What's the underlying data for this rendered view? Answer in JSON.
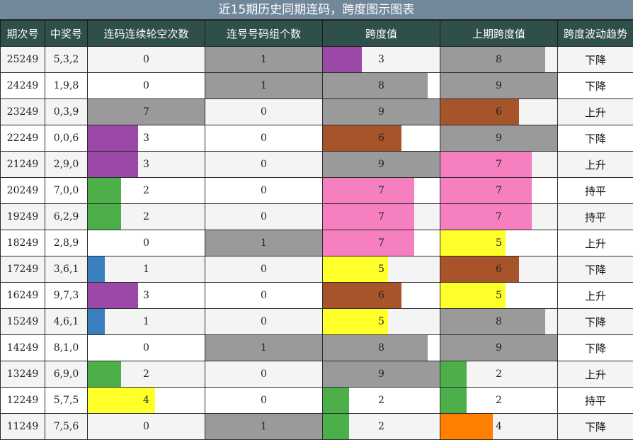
{
  "title": "近15期历史同期连码，跨度图示图表",
  "headers": [
    "期次号",
    "中奖号",
    "连码连续轮空次数",
    "连号号码组个数",
    "跨度值",
    "上期跨度值",
    "跨度波动趋势"
  ],
  "scale": {
    "miss_max": 7,
    "group_max": 1,
    "span_max": 9
  },
  "colors": {
    "1": "#3a7fc0",
    "2": "#4caf4a",
    "3": "#9a4aa6",
    "4": "#ffff2a",
    "5": "#ffff2a",
    "6": "#a8542a",
    "7": "#f57fbf",
    "8": "#9a9a9a",
    "9": "#9a9a9a",
    "4_prev": "#ff7f00"
  },
  "rows": [
    {
      "issue": "25249",
      "number": "5,3,2",
      "miss": 0,
      "groups": 1,
      "span": 3,
      "prev_span": 8,
      "trend": "下降"
    },
    {
      "issue": "24249",
      "number": "1,9,8",
      "miss": 0,
      "groups": 1,
      "span": 8,
      "prev_span": 9,
      "trend": "下降"
    },
    {
      "issue": "23249",
      "number": "0,3,9",
      "miss": 7,
      "groups": 0,
      "span": 9,
      "prev_span": 6,
      "trend": "上升"
    },
    {
      "issue": "22249",
      "number": "0,0,6",
      "miss": 3,
      "groups": 0,
      "span": 6,
      "prev_span": 9,
      "trend": "下降"
    },
    {
      "issue": "21249",
      "number": "2,9,0",
      "miss": 3,
      "groups": 0,
      "span": 9,
      "prev_span": 7,
      "trend": "上升"
    },
    {
      "issue": "20249",
      "number": "7,0,0",
      "miss": 2,
      "groups": 0,
      "span": 7,
      "prev_span": 7,
      "trend": "持平"
    },
    {
      "issue": "19249",
      "number": "6,2,9",
      "miss": 2,
      "groups": 0,
      "span": 7,
      "prev_span": 7,
      "trend": "持平"
    },
    {
      "issue": "18249",
      "number": "2,8,9",
      "miss": 0,
      "groups": 1,
      "span": 7,
      "prev_span": 5,
      "trend": "上升"
    },
    {
      "issue": "17249",
      "number": "3,6,1",
      "miss": 1,
      "groups": 0,
      "span": 5,
      "prev_span": 6,
      "trend": "下降"
    },
    {
      "issue": "16249",
      "number": "9,7,3",
      "miss": 3,
      "groups": 0,
      "span": 6,
      "prev_span": 5,
      "trend": "上升"
    },
    {
      "issue": "15249",
      "number": "4,6,1",
      "miss": 1,
      "groups": 0,
      "span": 5,
      "prev_span": 8,
      "trend": "下降"
    },
    {
      "issue": "14249",
      "number": "8,1,0",
      "miss": 0,
      "groups": 1,
      "span": 8,
      "prev_span": 9,
      "trend": "下降"
    },
    {
      "issue": "13249",
      "number": "6,9,0",
      "miss": 2,
      "groups": 0,
      "span": 9,
      "prev_span": 2,
      "trend": "上升"
    },
    {
      "issue": "12249",
      "number": "5,7,5",
      "miss": 4,
      "groups": 0,
      "span": 2,
      "prev_span": 2,
      "trend": "持平"
    },
    {
      "issue": "11249",
      "number": "7,5,6",
      "miss": 0,
      "groups": 1,
      "span": 2,
      "prev_span": 4,
      "trend": "下降"
    }
  ]
}
